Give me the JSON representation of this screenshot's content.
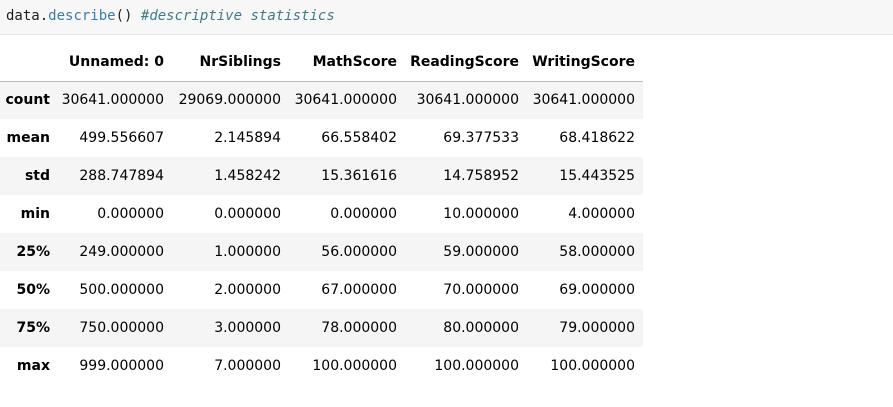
{
  "code": {
    "object": "data",
    "dot": ".",
    "method": "describe",
    "parens": "()",
    "space": " ",
    "comment": "#descriptive statistics"
  },
  "table": {
    "index_header": "",
    "columns": [
      "Unnamed: 0",
      "NrSiblings",
      "MathScore",
      "ReadingScore",
      "WritingScore"
    ],
    "rows": [
      {
        "label": "count",
        "values": [
          "30641.000000",
          "29069.000000",
          "30641.000000",
          "30641.000000",
          "30641.000000"
        ]
      },
      {
        "label": "mean",
        "values": [
          "499.556607",
          "2.145894",
          "66.558402",
          "69.377533",
          "68.418622"
        ]
      },
      {
        "label": "std",
        "values": [
          "288.747894",
          "1.458242",
          "15.361616",
          "14.758952",
          "15.443525"
        ]
      },
      {
        "label": "min",
        "values": [
          "0.000000",
          "0.000000",
          "0.000000",
          "10.000000",
          "4.000000"
        ]
      },
      {
        "label": "25%",
        "values": [
          "249.000000",
          "1.000000",
          "56.000000",
          "59.000000",
          "58.000000"
        ]
      },
      {
        "label": "50%",
        "values": [
          "500.000000",
          "2.000000",
          "67.000000",
          "70.000000",
          "69.000000"
        ]
      },
      {
        "label": "75%",
        "values": [
          "750.000000",
          "3.000000",
          "78.000000",
          "80.000000",
          "79.000000"
        ]
      },
      {
        "label": "max",
        "values": [
          "999.000000",
          "7.000000",
          "100.000000",
          "100.000000",
          "100.000000"
        ]
      }
    ]
  }
}
